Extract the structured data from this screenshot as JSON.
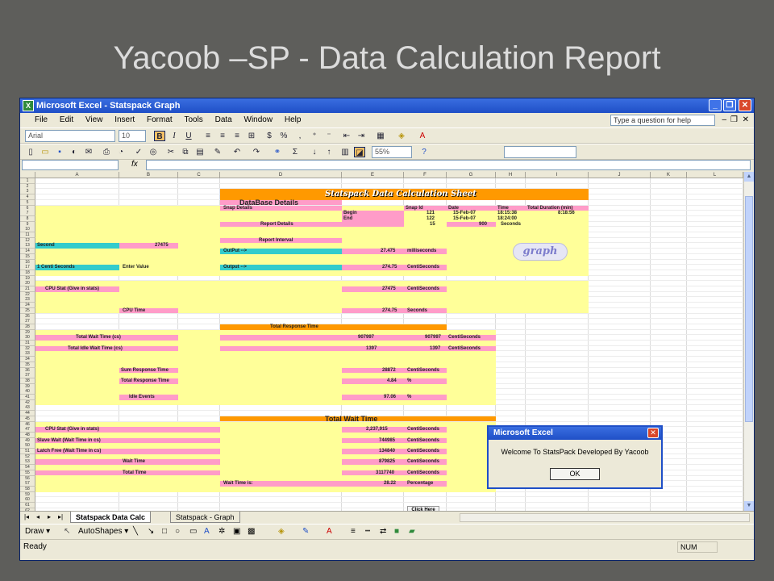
{
  "slide": {
    "title": "Yacoob –SP - Data Calculation Report"
  },
  "window": {
    "title": "Microsoft Excel - Statspack Graph",
    "app_icon": "excel-icon",
    "buttons": {
      "minimize": "_",
      "maximize": "❐",
      "close": "✕"
    }
  },
  "menu": {
    "items": [
      "File",
      "Edit",
      "View",
      "Insert",
      "Format",
      "Tools",
      "Data",
      "Window",
      "Help"
    ],
    "help_placeholder": "Type a question for help",
    "doc_buttons": {
      "minimize": "–",
      "restore": "❐",
      "close": "✕"
    }
  },
  "format_toolbar": {
    "font": "Arial",
    "size": "10",
    "bold": "B",
    "italic": "I",
    "underline": "U",
    "currency": "$",
    "percent": "%"
  },
  "standard_toolbar": {
    "zoom": "55%"
  },
  "formula_bar": {
    "fx": "fx"
  },
  "grid": {
    "columns": [
      "A",
      "B",
      "C",
      "D",
      "E",
      "F",
      "G",
      "H",
      "I",
      "J",
      "K",
      "L"
    ],
    "rows": [
      "1",
      "2",
      "3",
      "4",
      "5",
      "6",
      "7",
      "8",
      "9",
      "10",
      "11",
      "12",
      "13",
      "14",
      "15",
      "16",
      "17",
      "18",
      "19",
      "20",
      "21",
      "22",
      "23",
      "24",
      "25",
      "26",
      "27",
      "28",
      "29",
      "30",
      "31",
      "32",
      "33",
      "34",
      "35",
      "36",
      "37",
      "38",
      "39",
      "40",
      "41",
      "42",
      "43",
      "44",
      "45",
      "46",
      "47",
      "48",
      "49",
      "50",
      "51",
      "52",
      "53",
      "54",
      "55",
      "56",
      "57",
      "58",
      "59",
      "60",
      "61",
      "62",
      "63"
    ]
  },
  "sheet": {
    "title": "Statspack Data Calculation Sheet",
    "database_details": "DataBase Details",
    "snap_details": "Snap Details",
    "snap_id_hdr": "Snap Id",
    "date_hdr": "Date",
    "time_hdr": "Time",
    "total_duration_hdr": "Total Duration (min)",
    "begin_label": "Begin",
    "end_label": "End",
    "begin_id": "121",
    "end_id": "122",
    "begin_date": "15-Feb-07",
    "end_date": "15-Feb-07",
    "begin_time": "18:15:38",
    "end_time": "18:24:00",
    "duration": "8:18:56",
    "report_details": "Report Details",
    "report_value": "15",
    "report_seconds": "900",
    "seconds_unit": "Seconds",
    "report_interval": "Report Interval",
    "second_label": "Second",
    "second_value": "27475",
    "output_label_1": "OutPut -->",
    "output_value_1": "27.475",
    "output_unit_1": "milliseconds",
    "centi_label": "1 Centi Seconds",
    "enter_value": "Enter Value",
    "output_label_2": "Output -->",
    "output_value_2": "274.75",
    "output_unit_2": "CentiSeconds",
    "cpu_stat_label": "CPU Stat (Give in stats)",
    "cpu_stat_value": "27475",
    "cpu_stat_unit": "CentiSeconds",
    "cpu_time_label": "CPU Time",
    "cpu_time_value": "274.75",
    "cpu_time_unit": "Seconds",
    "total_response_time": "Total Response Time",
    "total_wait_label": "Total Wait Time (cs)",
    "total_wait_value": "907997",
    "total_wait_value2": "907997",
    "total_wait_unit": "CentiSeconds",
    "total_idle_label": "Total Idle Wait Time (cs)",
    "total_idle_value": "1397",
    "total_idle_value2": "1397",
    "total_idle_unit": "CentiSeconds",
    "sum_response_label": "Sum Response Time",
    "sum_response_value": "28872",
    "sum_response_unit": "CentiSeconds",
    "total_response_label": "Total Response Time",
    "total_response_value": "4.84",
    "percent_unit": "%",
    "idle_events_label": "Idle Events",
    "idle_events_value": "97.06",
    "total_wait_time": "Total Wait Time",
    "cpu_stat2_label": "CPU Stat (Give in stats)",
    "cpu_stat2_value": "2,237,915",
    "cpu_stat2_unit": "CentiSeconds",
    "slave_wait_label": "Slave Wait (Wait Time in cs)",
    "slave_wait_value": "744985",
    "slave_wait_unit": "CentiSeconds",
    "latch_free_label": "Latch Free (Wait Time in cs)",
    "latch_free_value": "134840",
    "latch_free_unit": "CentiSeconds",
    "wait_time_label": "Wait Time",
    "wait_time_value": "879825",
    "wait_time_unit": "CentiSeconds",
    "total_time_label": "Total Time",
    "total_time_value": "3117740",
    "total_time_unit": "CentiSeconds",
    "wait_time_is_label": "Wait Time is:",
    "wait_time_is_value": "28.22",
    "wait_time_is_unit": "Percentage",
    "graph_button": "graph",
    "click_here": "Click Here"
  },
  "tabs": [
    "Statspack Data Calc",
    "Statspack - Graph"
  ],
  "drawing_toolbar": {
    "draw": "Draw ▾",
    "autoshapes": "AutoShapes ▾"
  },
  "status": {
    "ready": "Ready",
    "num": "NUM"
  },
  "dialog": {
    "title": "Microsoft Excel",
    "message": "Welcome To StatsPack Developed By Yacoob",
    "ok": "OK",
    "close": "✕"
  }
}
